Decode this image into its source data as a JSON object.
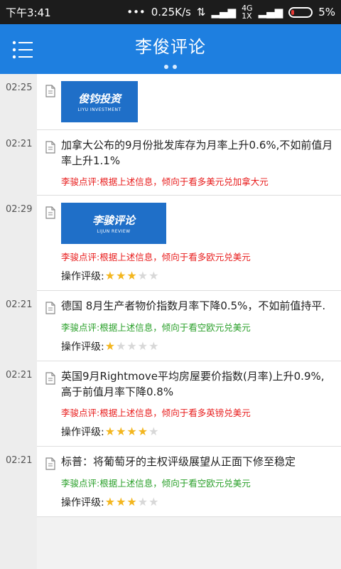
{
  "status": {
    "time": "下午3:41",
    "speed": "0.25K/s",
    "network_top": "4G",
    "network_bottom": "1X",
    "battery": "5%"
  },
  "header": {
    "title": "李俊评论"
  },
  "feed": {
    "rating_label": "操作评级:",
    "items": [
      {
        "time": "02:25",
        "type": "logo",
        "logo_text": "俊钧投资",
        "logo_sub": "LIYU INVESTMENT"
      },
      {
        "time": "02:21",
        "type": "news",
        "text": "加拿大公布的9月份批发库存为月率上升0.6%,不如前值月率上升1.1%",
        "comment": "李骏点评:根据上述信息，倾向于看多美元兑加拿大元",
        "comment_color": "#e81c1c"
      },
      {
        "time": "02:29",
        "type": "logo_rated",
        "logo_text": "李骏评论",
        "logo_sub": "LIJUN REVIEW",
        "comment": "李骏点评:根据上述信息，倾向于看多欧元兑美元",
        "comment_color": "#e81c1c",
        "rating": 3
      },
      {
        "time": "02:21",
        "type": "news_rated",
        "text": "德国 8月生产者物价指数月率下降0.5%，不如前值持平.",
        "comment": "李骏点评:根据上述信息，倾向于看空欧元兑美元",
        "comment_color": "#2aa02a",
        "rating": 1
      },
      {
        "time": "02:21",
        "type": "news_rated",
        "text": "英国9月Rightmove平均房屋要价指数(月率)上升0.9%,高于前值月率下降0.8%",
        "comment": "李骏点评:根据上述信息，倾向于看多英镑兑美元",
        "comment_color": "#e81c1c",
        "rating": 4
      },
      {
        "time": "02:21",
        "type": "news_rated",
        "text": "标普：将葡萄牙的主权评级展望从正面下修至稳定",
        "comment": "李骏点评:根据上述信息，倾向于看空欧元兑美元",
        "comment_color": "#2aa02a",
        "rating": 3
      }
    ]
  }
}
